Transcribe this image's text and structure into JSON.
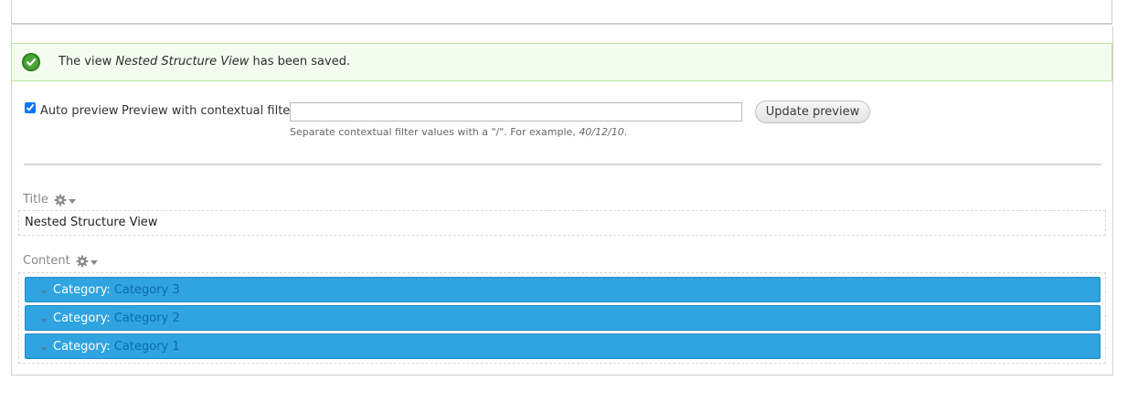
{
  "status": {
    "prefix": "The view",
    "view_name": "Nested Structure View",
    "suffix": "has been saved.",
    "icon": "checkmark-icon",
    "color": "#4aa437"
  },
  "preview": {
    "auto_preview_label": "Auto preview",
    "auto_preview_checked": true,
    "contextual_label": "Preview with contextual filters:",
    "contextual_value": "",
    "update_button": "Update preview",
    "help_prefix": "Separate contextual filter values with a \"/\". For example,",
    "help_example": "40/12/10",
    "help_suffix": "."
  },
  "title_section": {
    "label": "Title",
    "value": "Nested Structure View"
  },
  "content_section": {
    "label": "Content",
    "rows": [
      {
        "key": "Category:",
        "value": "Category 3"
      },
      {
        "key": "Category:",
        "value": "Category 2"
      },
      {
        "key": "Category:",
        "value": "Category 1"
      }
    ],
    "row_color": "#2fa4e1",
    "link_color": "#0b6bb3"
  }
}
